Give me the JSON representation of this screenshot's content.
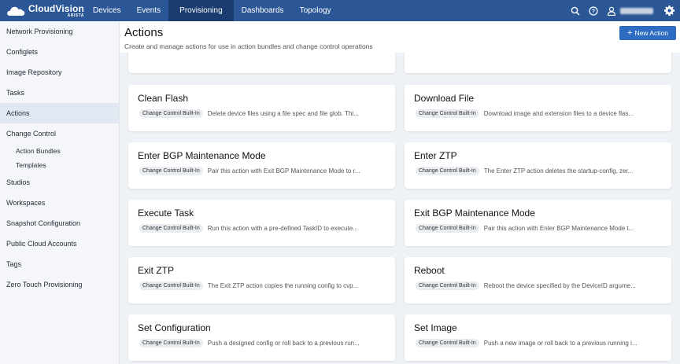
{
  "brand": {
    "name": "CloudVision",
    "sub": "ARISTA"
  },
  "nav": {
    "tabs": [
      {
        "label": "Devices"
      },
      {
        "label": "Events"
      },
      {
        "label": "Provisioning"
      },
      {
        "label": "Dashboards"
      },
      {
        "label": "Topology"
      }
    ],
    "active_tab": "Provisioning",
    "icons": [
      "search-icon",
      "help-icon",
      "user-icon",
      "settings-gear-icon"
    ]
  },
  "sidebar": {
    "items": [
      {
        "label": "Network Provisioning"
      },
      {
        "label": "Configlets"
      },
      {
        "label": "Image Repository"
      },
      {
        "label": "Tasks"
      },
      {
        "label": "Actions"
      },
      {
        "label": "Change Control"
      },
      {
        "label": "Action Bundles"
      },
      {
        "label": "Templates"
      },
      {
        "label": "Studios"
      },
      {
        "label": "Workspaces"
      },
      {
        "label": "Snapshot Configuration"
      },
      {
        "label": "Public Cloud Accounts"
      },
      {
        "label": "Tags"
      },
      {
        "label": "Zero Touch Provisioning"
      }
    ],
    "active_item": "Actions"
  },
  "page": {
    "title": "Actions",
    "description": "Create and manage actions for use in action bundles and change control operations",
    "new_button": "New Action"
  },
  "cards": [
    {
      "title": "Clean Flash",
      "badge": "Change Control Built-In",
      "desc": "Delete device files using a file spec and file glob. Thi..."
    },
    {
      "title": "Download File",
      "badge": "Change Control Built-In",
      "desc": "Download image and extension files to a device flas..."
    },
    {
      "title": "Enter BGP Maintenance Mode",
      "badge": "Change Control Built-In",
      "desc": "Pair this action with Exit BGP Maintenance Mode to r..."
    },
    {
      "title": "Enter ZTP",
      "badge": "Change Control Built-In",
      "desc": "The Enter ZTP action deletes the startup-config, zer..."
    },
    {
      "title": "Execute Task",
      "badge": "Change Control Built-In",
      "desc": "Run this action with a pre-defined TaskID to execute..."
    },
    {
      "title": "Exit BGP Maintenance Mode",
      "badge": "Change Control Built-In",
      "desc": "Pair this action with Enter BGP Maintenance Mode t..."
    },
    {
      "title": "Exit ZTP",
      "badge": "Change Control Built-In",
      "desc": "The Exit ZTP action copies the running config to cvp..."
    },
    {
      "title": "Reboot",
      "badge": "Change Control Built-In",
      "desc": "Reboot the device specified by the DeviceID argume..."
    },
    {
      "title": "Set Configuration",
      "badge": "Change Control Built-In",
      "desc": "Push a designed config or roll back to a previous run..."
    },
    {
      "title": "Set Image",
      "badge": "Change Control Built-In",
      "desc": "Push a new image or roll back to a previous running i..."
    }
  ]
}
